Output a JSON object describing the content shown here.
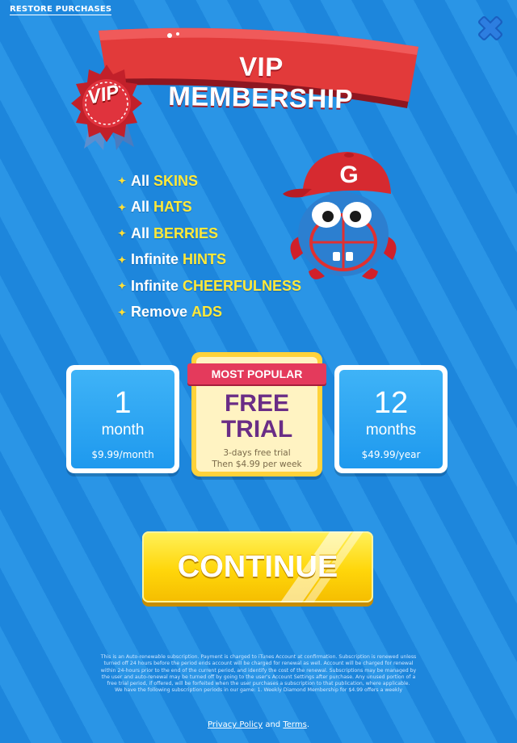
{
  "header": {
    "restore_label": "RESTORE PURCHASES",
    "close_icon": "close-x-icon"
  },
  "banner": {
    "title": "VIP MEMBERSHIP",
    "badge": "VIP"
  },
  "features": [
    {
      "prefix": "All",
      "highlight": "SKINS"
    },
    {
      "prefix": "All",
      "highlight": "HATS"
    },
    {
      "prefix": "All",
      "highlight": "BERRIES"
    },
    {
      "prefix": "Infinite",
      "highlight": "HINTS"
    },
    {
      "prefix": "Infinite",
      "highlight": "CHEERFULNESS"
    },
    {
      "prefix": "Remove",
      "highlight": "ADS"
    }
  ],
  "mascot": {
    "cap_letter": "G"
  },
  "plans": {
    "monthly": {
      "number": "1",
      "unit": "month",
      "price": "$9.99/month"
    },
    "trial": {
      "ribbon": "MOST POPULAR",
      "line1": "FREE",
      "line2": "TRIAL",
      "sub1": "3-days free trial",
      "sub2": "Then $4.99 per week"
    },
    "yearly": {
      "number": "12",
      "unit": "months",
      "price": "$49.99/year"
    }
  },
  "cta": {
    "label": "CONTINUE"
  },
  "legal": {
    "text": "This is an Auto-renewable subscription. Payment is charged to iTunes Account at confirmation. Subscription is renewed unless turned off 24 hours before the period ends account will be charged for renewal as well. Account will be charged for renewal within 24-hours prior to the end of the current period, and identify the cost of the renewal. Subscriptions may be managed by the user and auto-renewal may be turned off by going to the user's Account Settings after purchase. Any unused portion of a free trial period, if offered, will be forfeited when the user purchases a subscription to that publication, where applicable.",
    "text2": "We have the following subscription periods in our game: 1. Weekly Diamond Membership for $4.99 offers a weekly"
  },
  "footer": {
    "privacy": "Privacy Policy",
    "and": "and",
    "terms": "Terms",
    "period": "."
  },
  "colors": {
    "background": "#1f8ce0",
    "ribbon_red": "#e23a3a",
    "highlight_yellow": "#ffe93a",
    "trial_purple": "#6a2d86",
    "cta_yellow": "#ffd60a"
  }
}
